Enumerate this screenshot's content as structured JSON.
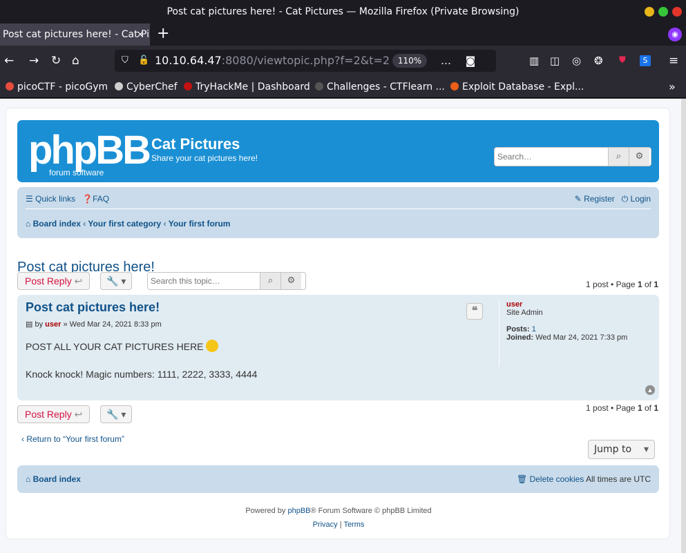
{
  "window": {
    "title": "Post cat pictures here! - Cat Pictures — Mozilla Firefox (Private Browsing)"
  },
  "tabs": [
    {
      "label": "Post cat pictures here! - Cat Pi",
      "close": "×"
    }
  ],
  "new_tab": "+",
  "url": {
    "host": "10.10.64.47",
    "rest": ":8080/viewtopic.php?f=2&t=2",
    "zoom": "110%"
  },
  "bookmarks": [
    {
      "label": "picoCTF - picoGym",
      "color": "#e74c3c"
    },
    {
      "label": "CyberChef",
      "color": "#cfcfcf"
    },
    {
      "label": "TryHackMe | Dashboard",
      "color": "#c11111"
    },
    {
      "label": "Challenges - CTFlearn ...",
      "color": "#555555"
    },
    {
      "label": "Exploit Database - Expl...",
      "color": "#ec5f1a"
    }
  ],
  "forum": {
    "logo_main": "phpBB",
    "logo_sub": "forum software",
    "site_name": "Cat Pictures",
    "site_desc": "Share your cat pictures here!",
    "search_placeholder": "Search…",
    "quick_links": "Quick links",
    "faq": "FAQ",
    "register": "Register",
    "login": "Login",
    "breadcrumbs": [
      "Board index",
      "Your first category",
      "Your first forum"
    ]
  },
  "topic": {
    "title": "Post cat pictures here!",
    "post_reply": "Post Reply",
    "search_placeholder": "Search this topic…",
    "pagination_prefix": "1 post • Page ",
    "page_current": "1",
    "page_sep": " of ",
    "page_total": "1"
  },
  "post": {
    "title": "Post cat pictures here!",
    "by": "by ",
    "author": "user",
    "date": " » Wed Mar 24, 2021 8:33 pm",
    "line1": "POST ALL YOUR CAT PICTURES HERE",
    "line2": "Knock knock! Magic numbers: 1111, 2222, 3333, 4444",
    "quote_icon": "❝"
  },
  "profile": {
    "name": "user",
    "rank": "Site Admin",
    "posts_label": "Posts:",
    "posts_value": "1",
    "joined_label": "Joined:",
    "joined_value": "Wed Mar 24, 2021 7:33 pm"
  },
  "bottom": {
    "return_link": "Return to “Your first forum”",
    "jump_to": "Jump to",
    "board_index": "Board index",
    "delete_cookies": "Delete cookies",
    "timezone": "All times are UTC"
  },
  "footer": {
    "powered_pre": "Powered by ",
    "powered_link": "phpBB",
    "powered_post": "® Forum Software © phpBB Limited",
    "privacy": "Privacy",
    "sep": " | ",
    "terms": "Terms"
  }
}
